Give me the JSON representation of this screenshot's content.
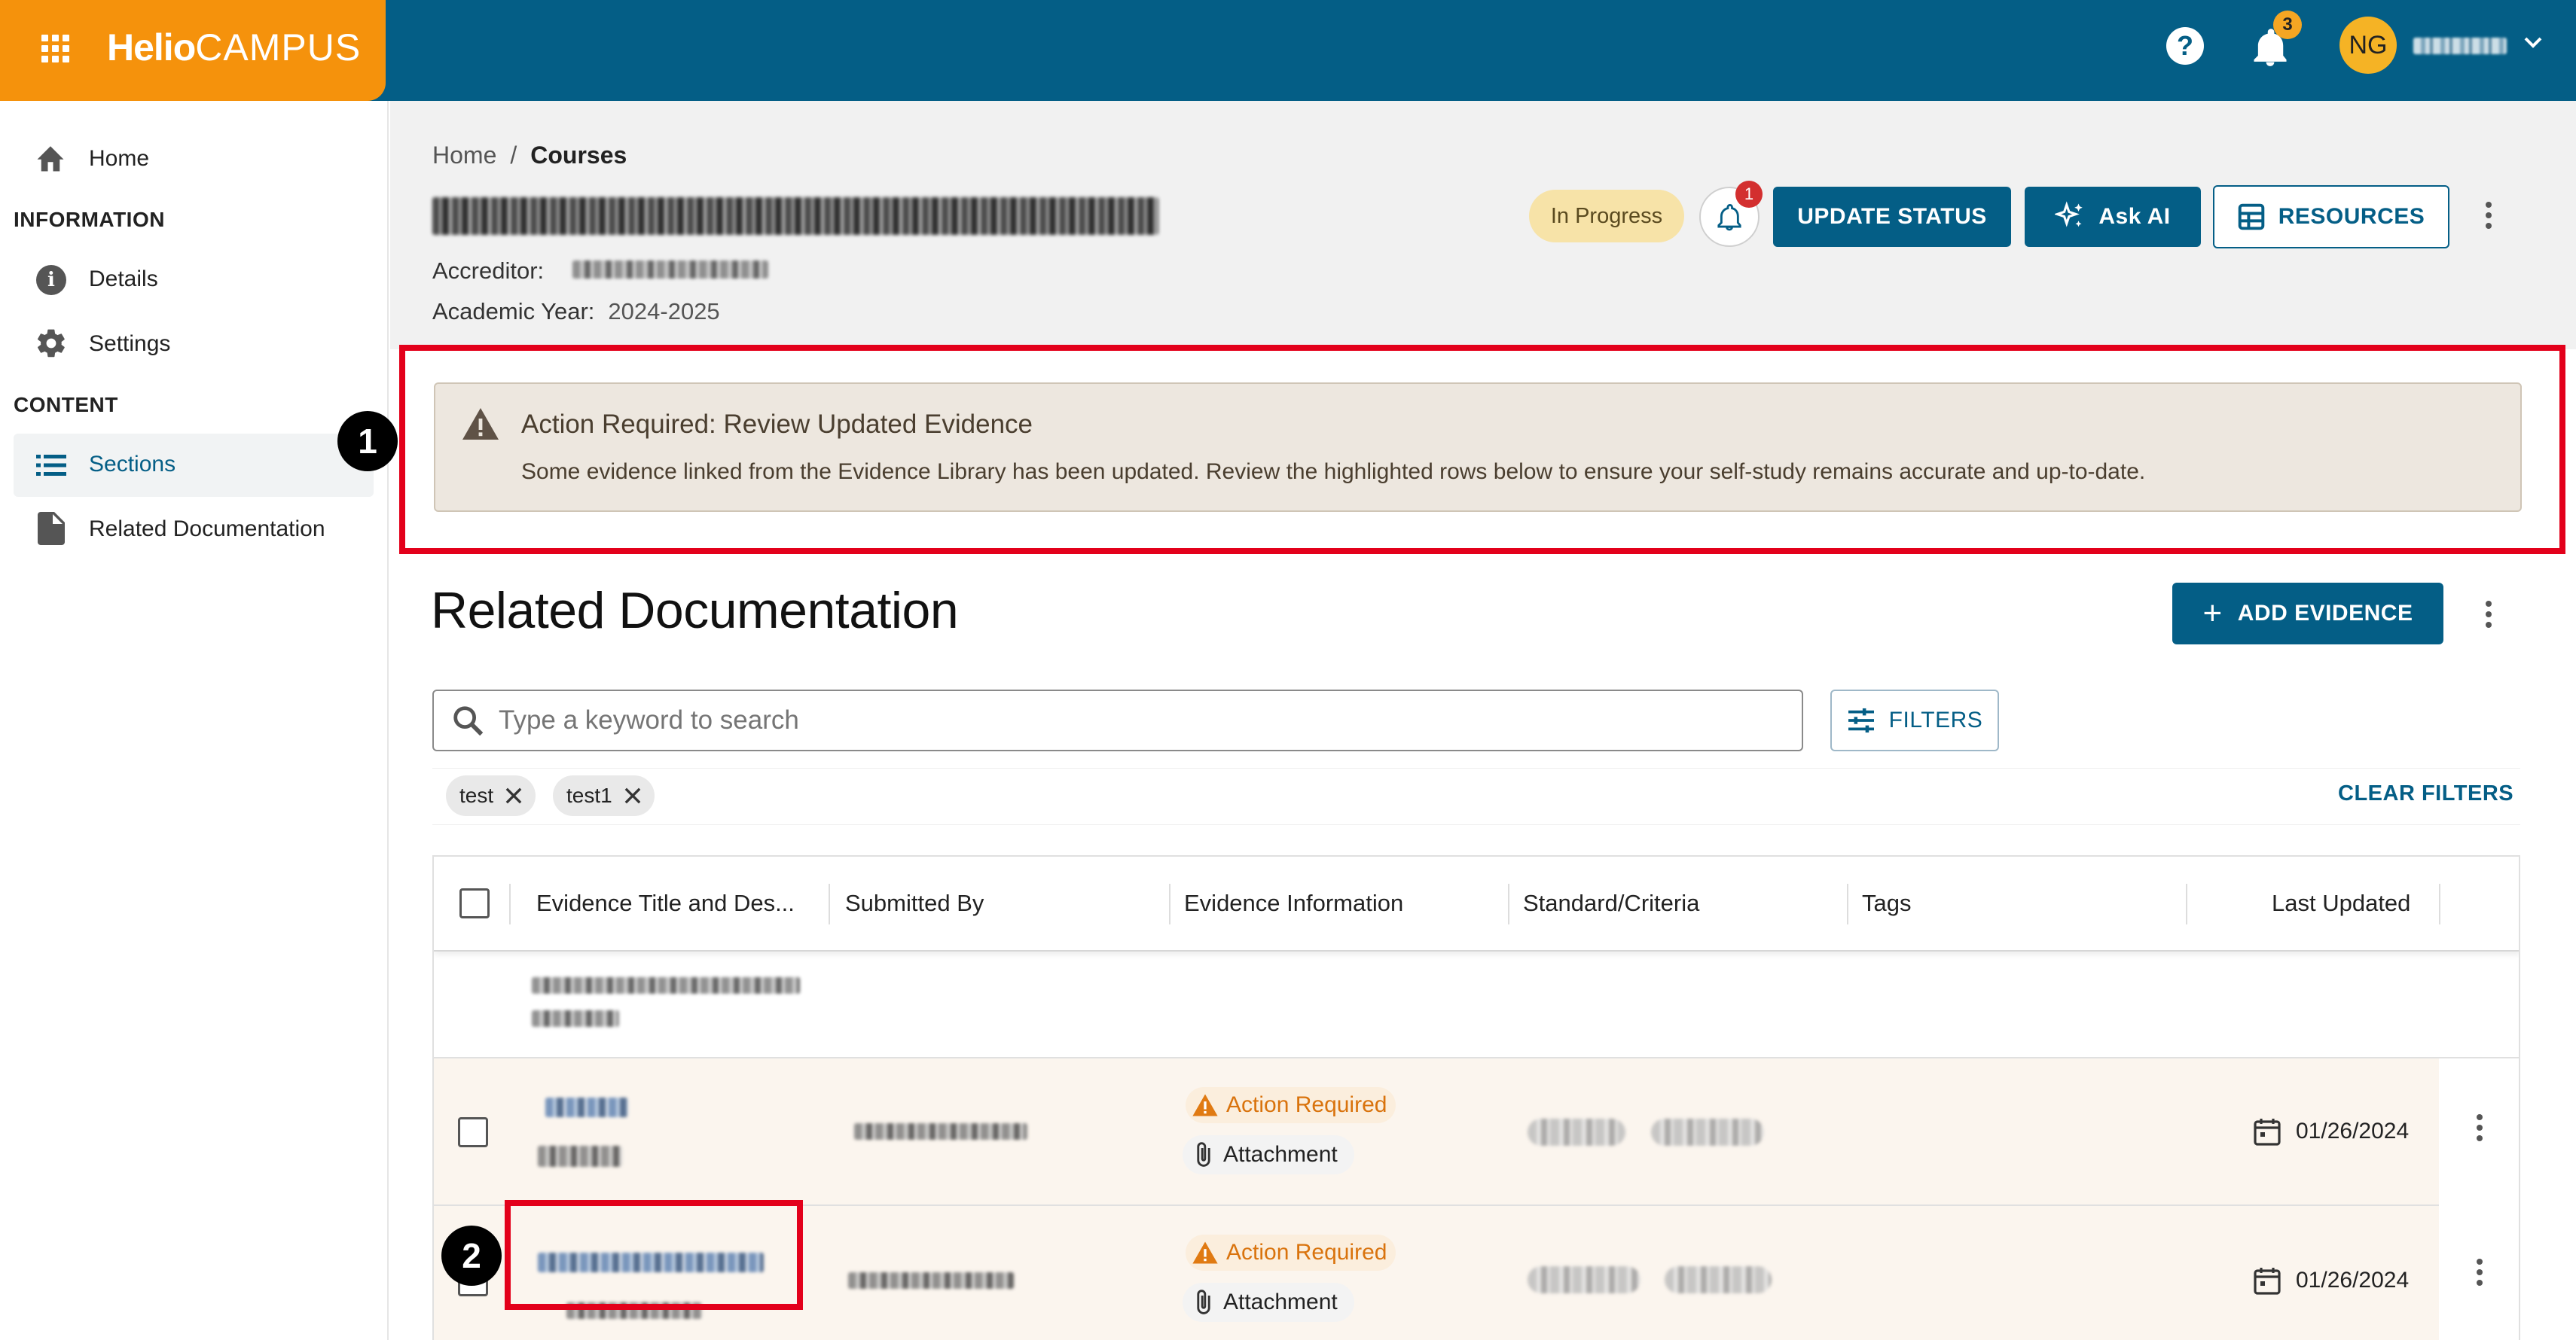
{
  "app": {
    "brand_part1": "Helio",
    "brand_part2": "CAMPUS",
    "notification_count": "3",
    "user_initials": "NG"
  },
  "sidebar": {
    "home_label": "Home",
    "information_heading": "INFORMATION",
    "details_label": "Details",
    "settings_label": "Settings",
    "content_heading": "CONTENT",
    "sections_label": "Sections",
    "related_docs_label": "Related Documentation"
  },
  "header": {
    "breadcrumb_home": "Home",
    "breadcrumb_sep": "/",
    "breadcrumb_courses": "Courses",
    "accreditor_label": "Accreditor:",
    "academic_year_label": "Academic Year:",
    "academic_year_value": "2024-2025",
    "status_badge": "In Progress",
    "bell_badge": "1",
    "update_status_label": "UPDATE STATUS",
    "ask_ai_label": "Ask AI",
    "resources_label": "RESOURCES"
  },
  "alert": {
    "title": "Action Required: Review Updated Evidence",
    "message": "Some evidence linked from the Evidence Library has been updated. Review the highlighted rows below to ensure your self-study remains accurate and up-to-date."
  },
  "annotations": {
    "marker1": "1",
    "marker2": "2"
  },
  "section": {
    "title": "Related Documentation",
    "add_evidence_label": "ADD EVIDENCE"
  },
  "search": {
    "placeholder": "Type a keyword to search",
    "filters_label": "FILTERS"
  },
  "filters": {
    "chips": [
      "test",
      "test1"
    ],
    "clear_label": "CLEAR FILTERS"
  },
  "table": {
    "columns": [
      "Evidence Title and Des...",
      "Submitted By",
      "Evidence Information",
      "Standard/Criteria",
      "Tags",
      "Last Updated"
    ],
    "rows": [
      {
        "action": "Action Required",
        "attachment": "Attachment",
        "date": "01/26/2024"
      },
      {
        "action": "Action Required",
        "attachment": "Attachment",
        "date": "01/26/2024"
      }
    ]
  },
  "colors": {
    "topbar": "#045e86",
    "brand_orange": "#f5920c",
    "accent_red": "#e3001b",
    "warning_orange": "#d9730d",
    "alert_bg": "#ede7df",
    "highlight_row": "#fbf5ee"
  }
}
